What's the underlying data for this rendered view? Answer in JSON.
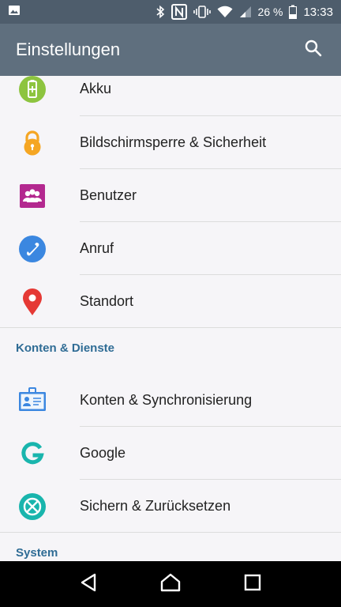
{
  "status_bar": {
    "battery_percent": "26 %",
    "time": "13:33"
  },
  "app_bar": {
    "title": "Einstellungen"
  },
  "items": [
    {
      "label": "Akku",
      "icon": "battery-icon"
    },
    {
      "label": "Bildschirmsperre & Sicherheit",
      "icon": "lock-icon"
    },
    {
      "label": "Benutzer",
      "icon": "users-icon"
    },
    {
      "label": "Anruf",
      "icon": "phone-icon"
    },
    {
      "label": "Standort",
      "icon": "location-pin-icon"
    }
  ],
  "sections": [
    {
      "title": "Konten & Dienste",
      "items": [
        {
          "label": "Konten & Synchronisierung",
          "icon": "account-card-icon"
        },
        {
          "label": "Google",
          "icon": "google-icon"
        },
        {
          "label": "Sichern & Zurücksetzen",
          "icon": "backup-reset-icon"
        }
      ]
    },
    {
      "title": "System",
      "items": []
    }
  ],
  "colors": {
    "app_bar": "#5f6f7e",
    "status_bar": "#4e5d6c",
    "section_header": "#2f6c95",
    "battery_icon": "#8dc43f",
    "lock_icon": "#f5a623",
    "users_icon": "#b3288f",
    "phone_icon": "#3b87e0",
    "location_icon": "#e53935",
    "google_icon": "#19b5ad"
  }
}
